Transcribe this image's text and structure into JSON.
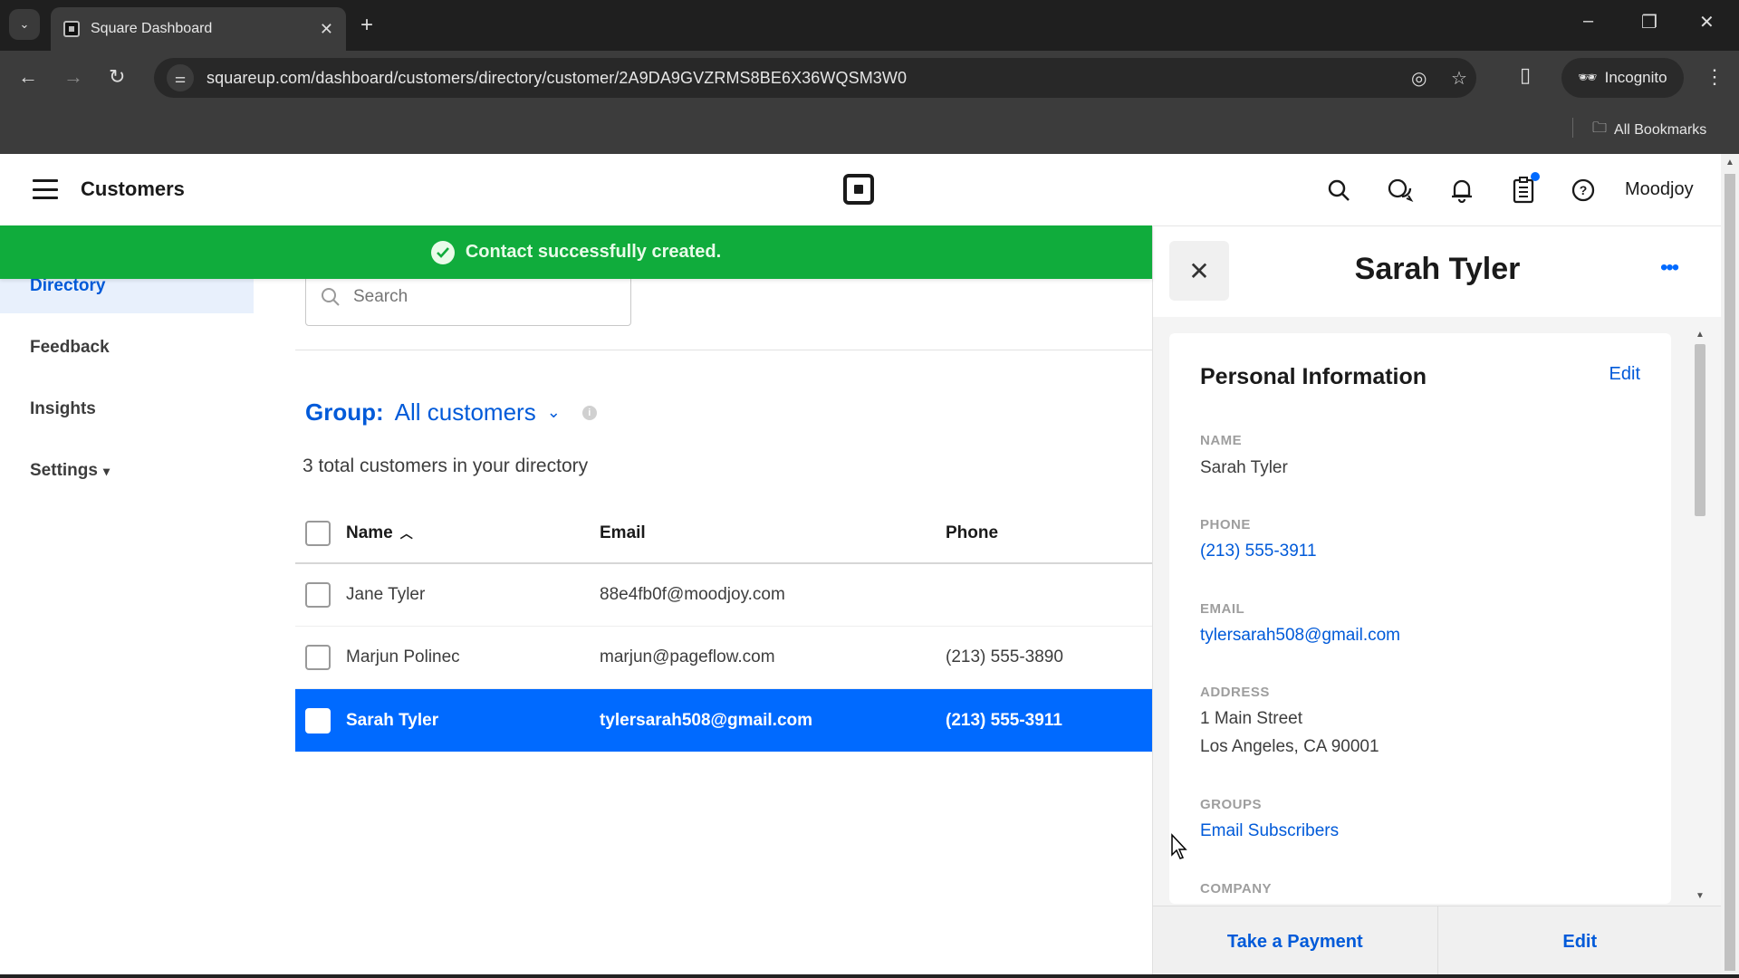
{
  "browser": {
    "tab_title": "Square Dashboard",
    "url": "squareup.com/dashboard/customers/directory/customer/2A9DA9GVZRMS8BE6X36WQSM3W0",
    "incognito_label": "Incognito",
    "all_bookmarks_label": "All Bookmarks"
  },
  "header": {
    "title": "Customers",
    "merchant_name": "Moodjoy",
    "icons": [
      "search-icon",
      "messages-icon",
      "bell-icon",
      "clipboard-icon",
      "help-icon"
    ],
    "accent_color": "#006aff"
  },
  "banner": {
    "message": "Contact successfully created.",
    "color": "#10ac3c"
  },
  "sidebar": {
    "items": [
      {
        "label": "Directory",
        "active": true
      },
      {
        "label": "Feedback",
        "active": false
      },
      {
        "label": "Insights",
        "active": false
      },
      {
        "label": "Settings",
        "active": false,
        "has_chevron": true
      }
    ]
  },
  "directory": {
    "search_placeholder": "Search",
    "group_label": "Group:",
    "group_value": "All customers",
    "total_text": "3 total customers in your directory",
    "columns": {
      "name": "Name",
      "email": "Email",
      "phone": "Phone"
    },
    "sort_indicator": "^",
    "rows": [
      {
        "name": "Jane Tyler",
        "email": "88e4fb0f@moodjoy.com",
        "phone": "",
        "selected": false
      },
      {
        "name": "Marjun Polinec",
        "email": "marjun@pageflow.com",
        "phone": "(213) 555-3890",
        "selected": false
      },
      {
        "name": "Sarah Tyler",
        "email": "tylersarah508@gmail.com",
        "phone": "(213) 555-3911",
        "selected": true
      }
    ]
  },
  "detail": {
    "title": "Sarah Tyler",
    "card_title": "Personal Information",
    "card_edit": "Edit",
    "fields": {
      "name_label": "NAME",
      "name_value": "Sarah Tyler",
      "phone_label": "PHONE",
      "phone_value": "(213) 555-3911",
      "email_label": "EMAIL",
      "email_value": "tylersarah508@gmail.com",
      "address_label": "ADDRESS",
      "address_line1": "1 Main Street",
      "address_line2": "Los Angeles, CA 90001",
      "groups_label": "GROUPS",
      "groups_value": "Email Subscribers",
      "company_label": "COMPANY"
    },
    "footer": {
      "take_payment": "Take a Payment",
      "edit": "Edit"
    }
  }
}
